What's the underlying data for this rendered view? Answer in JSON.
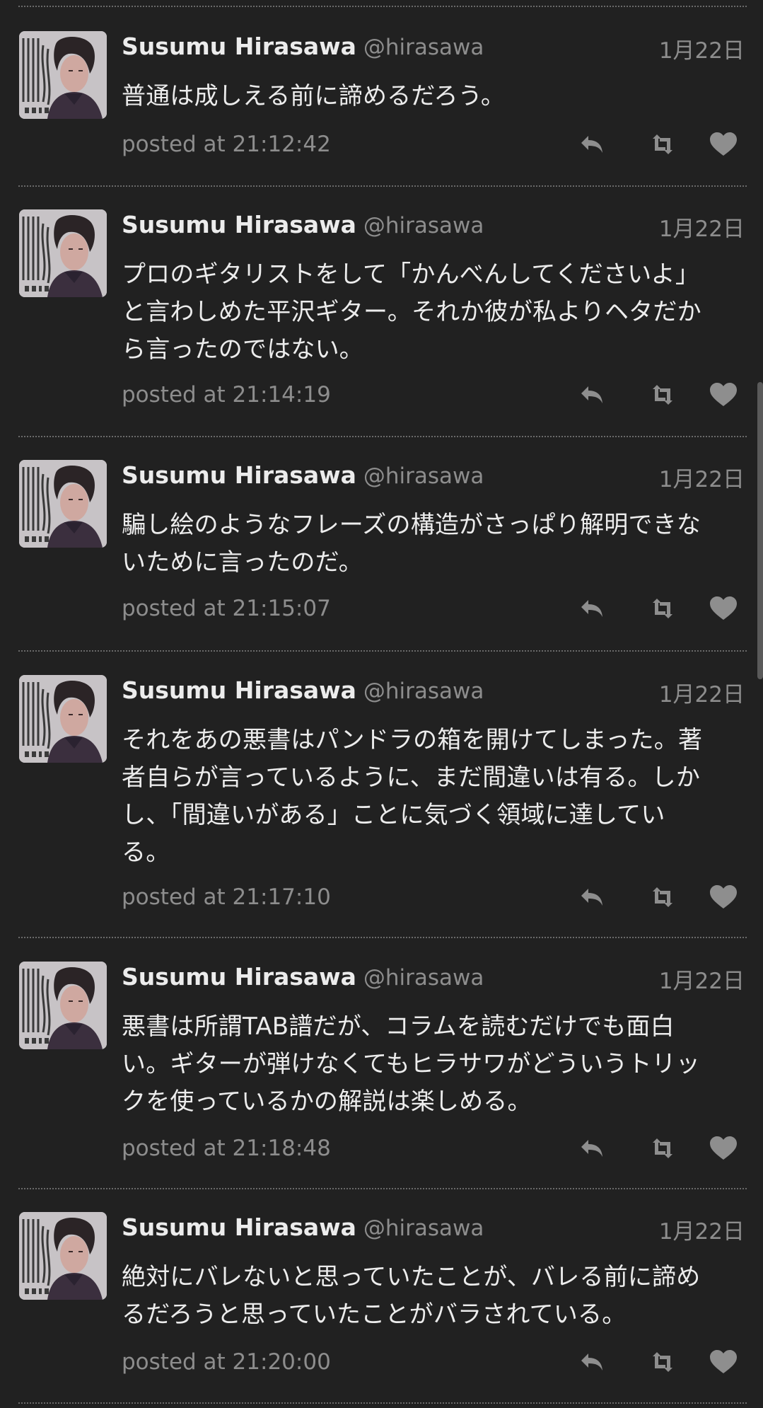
{
  "colors": {
    "background": "#212121",
    "text": "#ececec",
    "muted": "#8d8d8d",
    "icon": "#8e8e8e"
  },
  "icons": {
    "reply": "reply-icon",
    "retweet": "retweet-icon",
    "like": "heart-icon"
  },
  "tweets": [
    {
      "name": "Susumu Hirasawa",
      "handle": "@hirasawa",
      "date": "1月22日",
      "text": "普通は成しえる前に諦めるだろう。",
      "posted": "posted at 21:12:42"
    },
    {
      "name": "Susumu Hirasawa",
      "handle": "@hirasawa",
      "date": "1月22日",
      "text": "プロのギタリストをして「かんべんしてくださいよ」\nと言わしめた平沢ギター。それか彼が私よりヘタだか\nら言ったのではない。",
      "posted": "posted at 21:14:19"
    },
    {
      "name": "Susumu Hirasawa",
      "handle": "@hirasawa",
      "date": "1月22日",
      "text": "騙し絵のようなフレーズの構造がさっぱり解明できな\nいために言ったのだ。",
      "posted": "posted at 21:15:07"
    },
    {
      "name": "Susumu Hirasawa",
      "handle": "@hirasawa",
      "date": "1月22日",
      "text": "それをあの悪書はパンドラの箱を開けてしまった。著\n者自らが言っているように、まだ間違いは有る。しか\nし、「間違いがある」ことに気づく領域に達してい\nる。",
      "posted": "posted at 21:17:10"
    },
    {
      "name": "Susumu Hirasawa",
      "handle": "@hirasawa",
      "date": "1月22日",
      "text": "悪書は所謂TAB譜だが、コラムを読むだけでも面白\nい。ギターが弾けなくてもヒラサワがどういうトリッ\nクを使っているかの解説は楽しめる。",
      "posted": "posted at 21:18:48"
    },
    {
      "name": "Susumu Hirasawa",
      "handle": "@hirasawa",
      "date": "1月22日",
      "text": "絶対にバレないと思っていたことが、バレる前に諦め\nるだろうと思っていたことがバラされている。",
      "posted": "posted at 21:20:00"
    }
  ]
}
